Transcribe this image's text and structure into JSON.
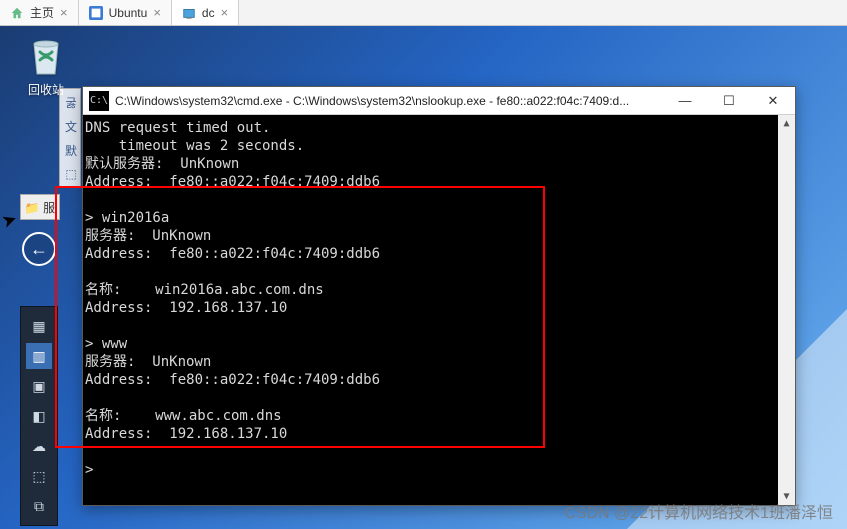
{
  "tabs": [
    {
      "label": "主页",
      "icon": "home"
    },
    {
      "label": "Ubuntu",
      "icon": "ubuntu"
    },
    {
      "label": "dc",
      "icon": "windows",
      "active": true
    }
  ],
  "desktop": {
    "recycle_label": "回收站"
  },
  "vtool_hints": [
    "굻",
    "文",
    "默",
    "⬚"
  ],
  "dock_head": "📁 服",
  "back_label": "←",
  "dock_items": [
    "▦",
    "▥",
    "▣",
    "◧",
    "☁",
    "⬚",
    "⧉"
  ],
  "dock_active_index": 1,
  "cmd": {
    "icon_text": "C:\\",
    "title": "C:\\Windows\\system32\\cmd.exe - C:\\Windows\\system32\\nslookup.exe  - fe80::a022:f04c:7409:d...",
    "min": "—",
    "max": "☐",
    "close": "✕",
    "lines": [
      "DNS request timed out.",
      "    timeout was 2 seconds.",
      "默认服务器:  UnKnown",
      "Address:  fe80::a022:f04c:7409:ddb6",
      "",
      "> win2016a",
      "服务器:  UnKnown",
      "Address:  fe80::a022:f04c:7409:ddb6",
      "",
      "名称:    win2016a.abc.com.dns",
      "Address:  192.168.137.10",
      "",
      "> www",
      "服务器:  UnKnown",
      "Address:  fe80::a022:f04c:7409:ddb6",
      "",
      "名称:    www.abc.com.dns",
      "Address:  192.168.137.10",
      "",
      "> "
    ]
  },
  "watermark": "CSDN @22计算机网络技术1班潘泽恒"
}
